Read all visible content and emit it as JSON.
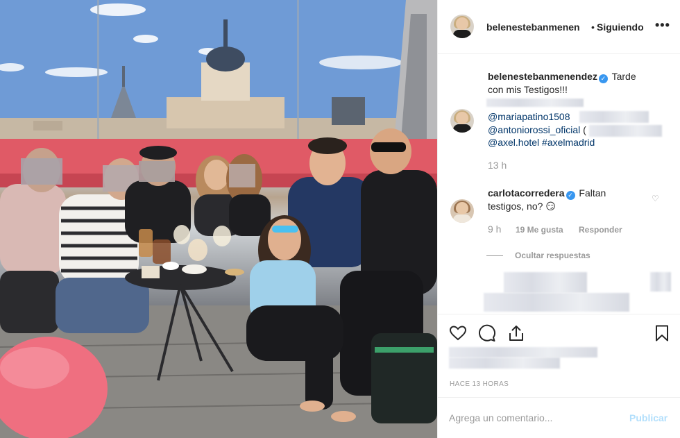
{
  "header": {
    "username": "belenestebanmenen",
    "separator": "•",
    "follow_status": "Siguiendo",
    "more_icon": "•••"
  },
  "caption": {
    "username": "belenestebanmenendez",
    "text_line1": "Tarde",
    "text_line2": "con mis Testigos!!!",
    "mention1": "@mariapatino1508",
    "mention2": "@antoniorossi_oficial",
    "mention2_suffix": "(",
    "mention3": "@axel.hotel",
    "hashtag": "#axelmadrid",
    "time": "13 h"
  },
  "comment": {
    "username": "carlotacorredera",
    "text_line1": "Faltan",
    "text_line2": "testigos, no? 😏",
    "time": "9 h",
    "likes": "19 Me gusta",
    "reply": "Responder",
    "hide_replies": "Ocultar respuestas"
  },
  "actions": {
    "like_icon": "heart-icon",
    "comment_icon": "comment-icon",
    "share_icon": "share-icon",
    "save_icon": "bookmark-icon",
    "timestamp": "HACE 13 HORAS"
  },
  "add_comment": {
    "placeholder": "Agrega un comentario...",
    "post_label": "Publicar"
  },
  "colors": {
    "link": "#003569",
    "verified": "#3897f0",
    "post_disabled": "#b2dffc",
    "meta": "#999999"
  }
}
